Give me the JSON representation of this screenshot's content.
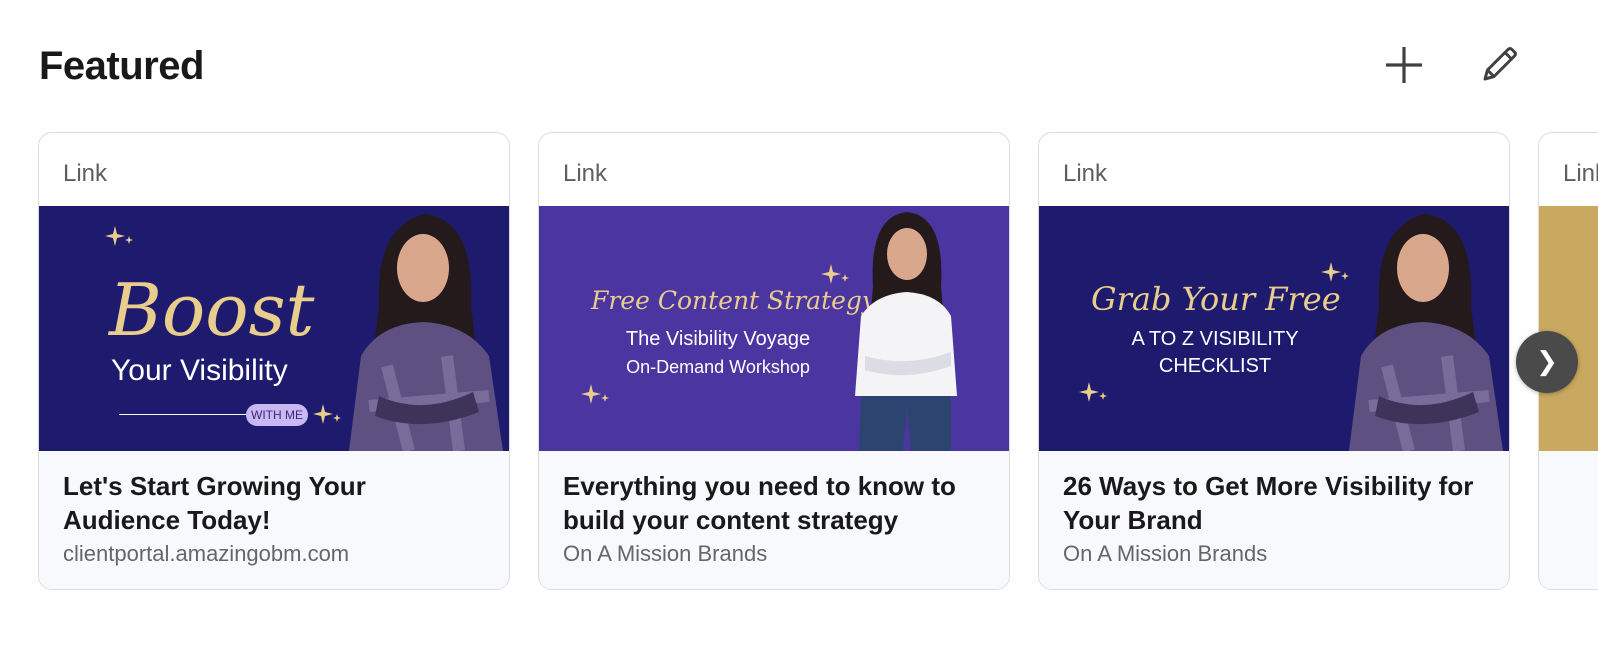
{
  "section": {
    "title": "Featured"
  },
  "header_actions": {
    "add_icon": "plus-icon",
    "edit_icon": "pencil-icon"
  },
  "colors": {
    "navy": "#1e1b6e",
    "purple": "#4b35a0",
    "gold": "#e9cd8c",
    "pill": "#c9b8f2"
  },
  "cards": [
    {
      "type": "Link",
      "thumb": {
        "script": "Boost",
        "line1": "Your Visibility",
        "pill": "WITH ME"
      },
      "title": "Let's Start Growing Your Audience Today!",
      "subtitle": "clientportal.amazingobm.com"
    },
    {
      "type": "Link",
      "thumb": {
        "script": "Free Content Strategy",
        "line1": "The Visibility Voyage",
        "line2": "On-Demand Workshop"
      },
      "title": "Everything you need to know to build your content strategy",
      "subtitle": "On A Mission Brands"
    },
    {
      "type": "Link",
      "thumb": {
        "script": "Grab Your Free",
        "line1": "A TO Z VISIBILITY",
        "line2": "CHECKLIST"
      },
      "title": "26 Ways to Get More Visibility for Your Brand",
      "subtitle": "On A Mission Brands"
    },
    {
      "type": "Link",
      "title": "",
      "subtitle": ""
    }
  ],
  "carousel": {
    "next_icon": "chevron-right-icon",
    "next_glyph": "❯"
  }
}
